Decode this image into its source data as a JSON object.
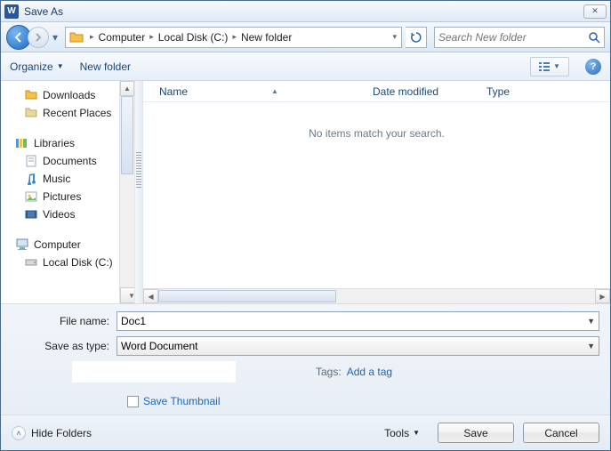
{
  "title": "Save As",
  "breadcrumb": [
    "Computer",
    "Local Disk (C:)",
    "New folder"
  ],
  "search": {
    "placeholder": "Search New folder"
  },
  "toolbar": {
    "organize": "Organize",
    "newfolder": "New folder"
  },
  "tree": {
    "downloads": "Downloads",
    "recent": "Recent Places",
    "libraries": "Libraries",
    "documents": "Documents",
    "music": "Music",
    "pictures": "Pictures",
    "videos": "Videos",
    "computer": "Computer",
    "localdisk": "Local Disk (C:)"
  },
  "columns": {
    "name": "Name",
    "date": "Date modified",
    "type": "Type"
  },
  "empty": "No items match your search.",
  "filename_label": "File name:",
  "filename_value": "Doc1",
  "saveastype_label": "Save as type:",
  "saveastype_value": "Word Document",
  "tags_label": "Tags:",
  "tags_add": "Add a tag",
  "save_thumbnail": "Save Thumbnail",
  "hide_folders": "Hide Folders",
  "tools": "Tools",
  "save": "Save",
  "cancel": "Cancel"
}
